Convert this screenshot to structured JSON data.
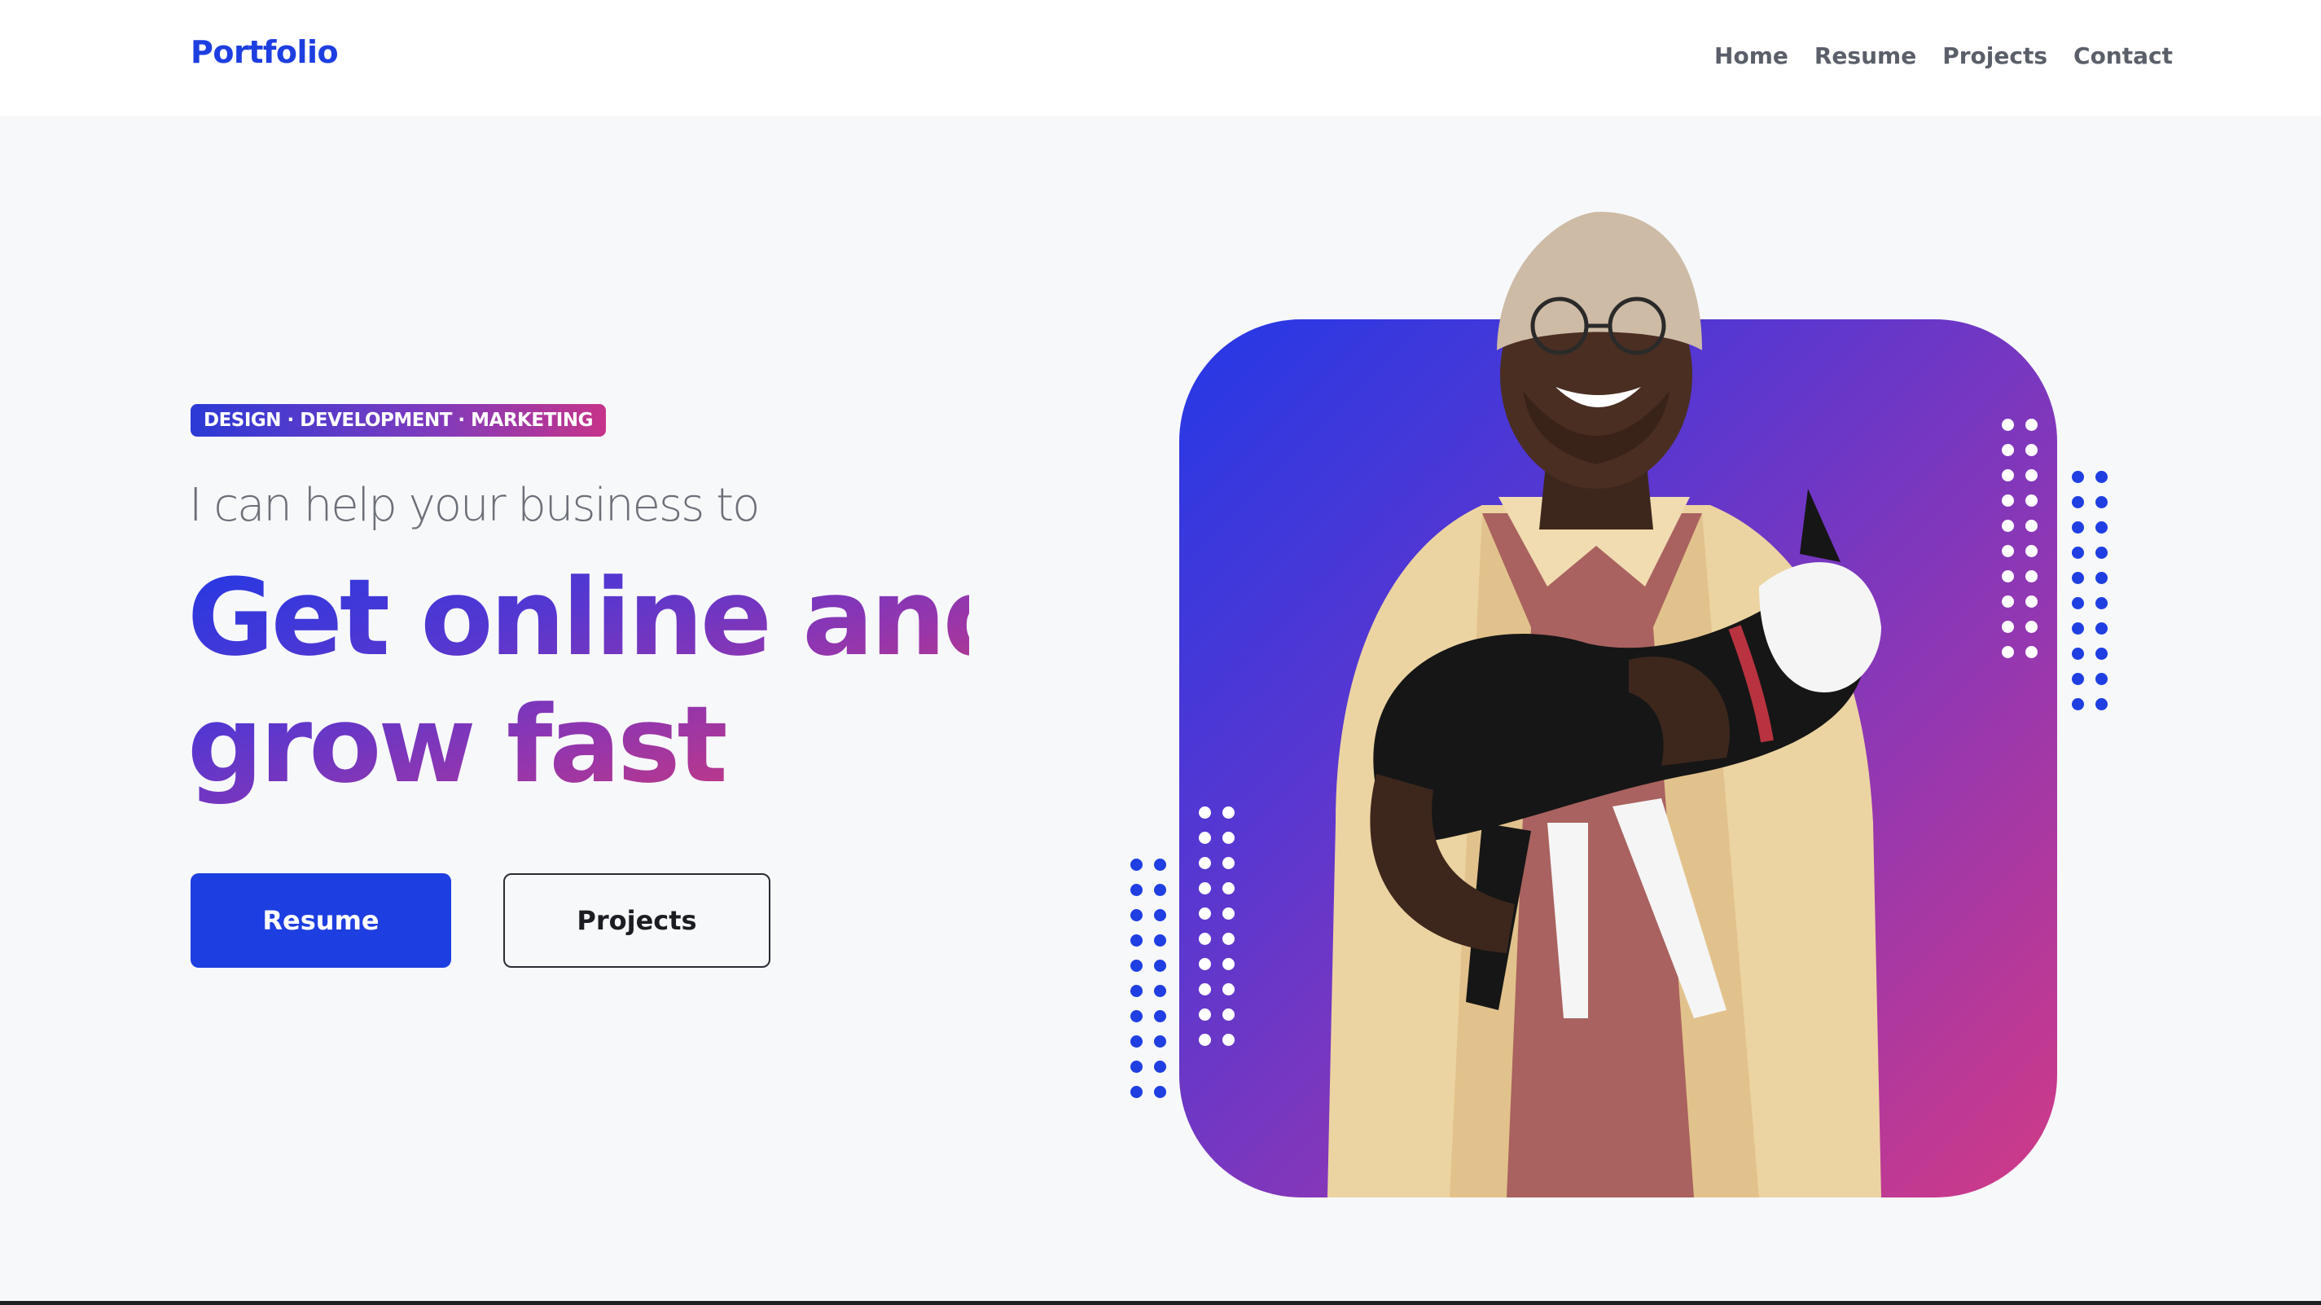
{
  "header": {
    "logo": "Portfolio",
    "nav": [
      "Home",
      "Resume",
      "Projects",
      "Contact"
    ]
  },
  "hero": {
    "badge": "DESIGN · DEVELOPMENT · MARKETING",
    "subheading": "I can help your business to",
    "headline_line1": "Get online and",
    "headline_line2": "grow fast",
    "primary_button": "Resume",
    "secondary_button": "Projects"
  },
  "colors": {
    "brand_blue": "#1d3ee0",
    "gradient_purple": "#7a3bc0",
    "gradient_pink": "#c6348a",
    "background": "#f7f8fa"
  },
  "image": {
    "subject": "Smiling man in beanie and glasses holding a black and white dog"
  }
}
